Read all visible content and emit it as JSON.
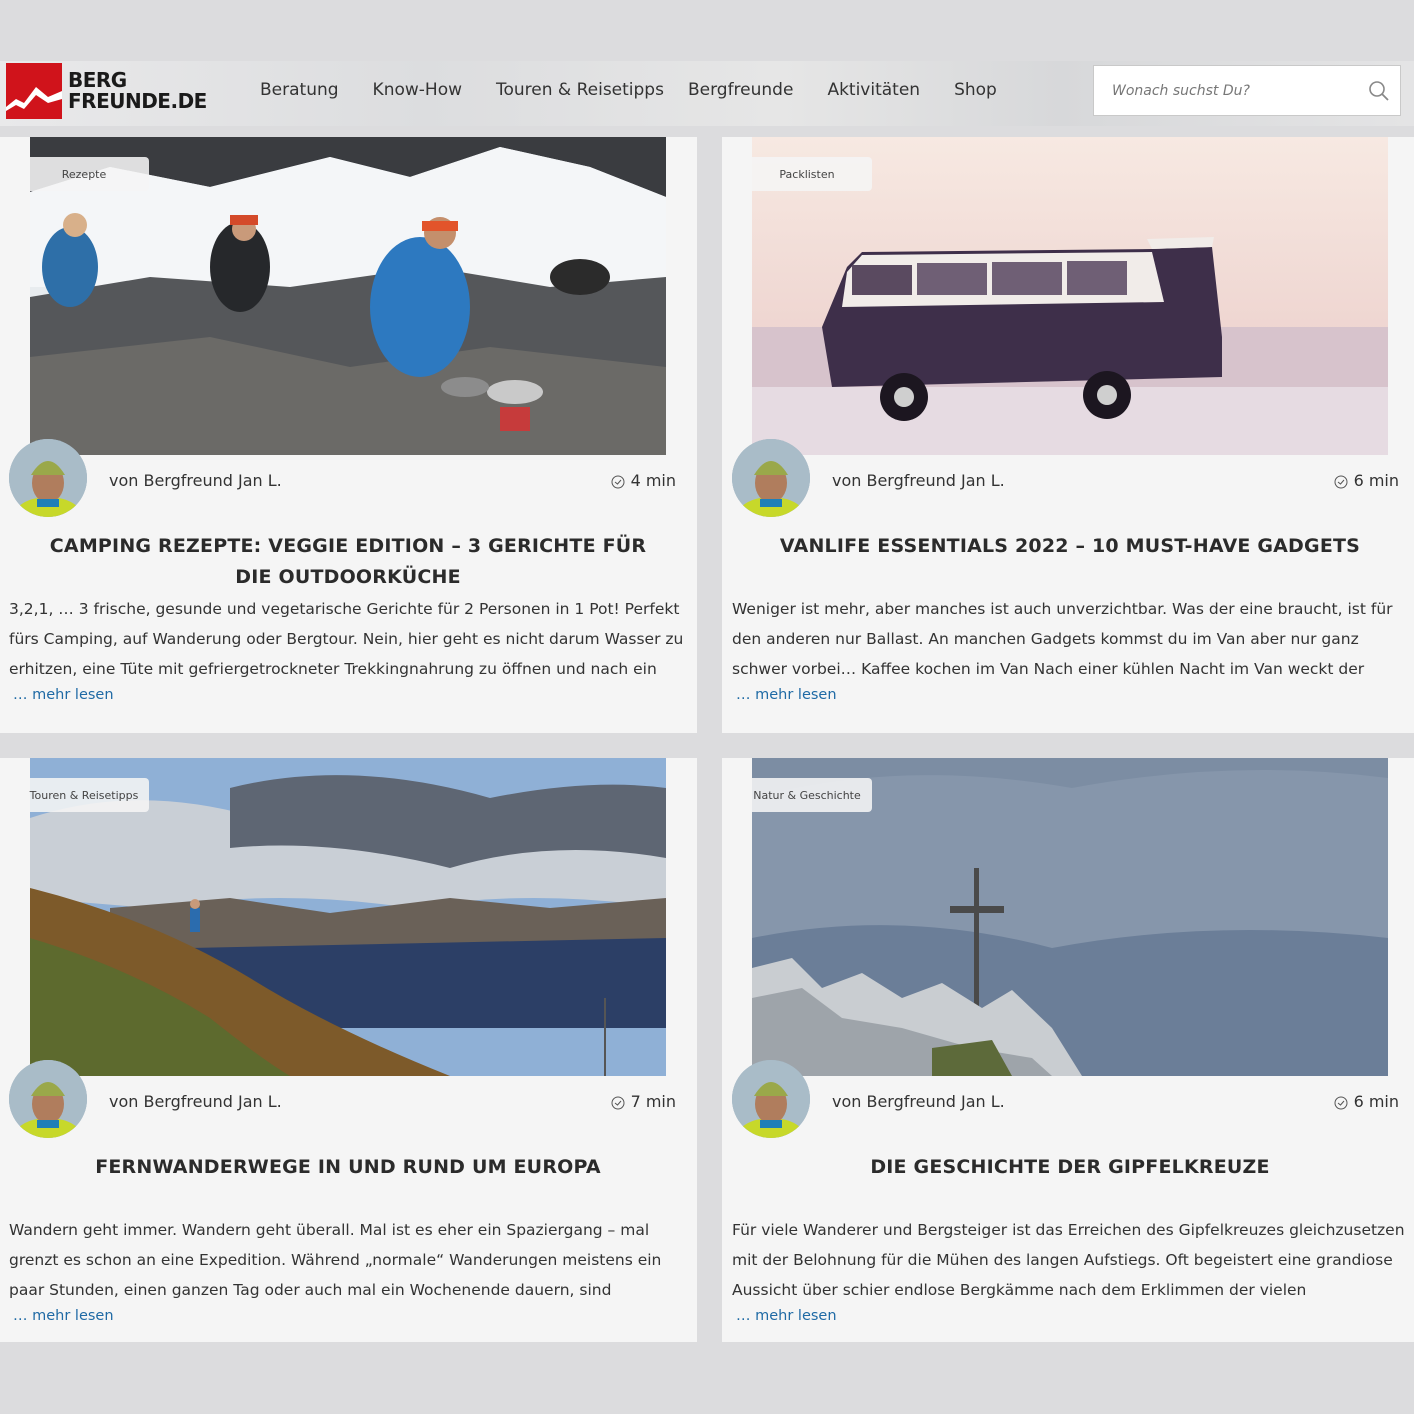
{
  "header": {
    "logo_line1": "BERG",
    "logo_line2": "FREUNDE.DE",
    "nav": [
      "Beratung",
      "Know-How",
      "Touren & Reisetipps",
      "Bergfreunde",
      "Aktivitäten",
      "Shop"
    ],
    "search_placeholder": "Wonach suchst Du?"
  },
  "colors": {
    "brand_red": "#d0131b",
    "link": "#1f6aa5",
    "card_bg": "#f5f5f5"
  },
  "articles": [
    {
      "category": "Rezepte",
      "author": "von Bergfreund Jan L.",
      "read_time": "4 min",
      "title": "Camping Rezepte: Veggie Edition – 3 Gerichte für die Outdoorküche",
      "excerpt": "3,2,1, … 3 frische, gesunde und vegetarische Gerichte für 2 Personen in 1 Pot! Perfekt fürs Camping, auf Wanderung oder Bergtour. Nein, hier geht es nicht darum Wasser zu erhitzen, eine Tüte mit gefriergetrockneter Trekkingnahrung zu öffnen und nach ein paar Minuten, die",
      "more": "… mehr lesen"
    },
    {
      "category": "Packlisten",
      "author": "von Bergfreund Jan L.",
      "read_time": "6 min",
      "title": "Vanlife Essentials 2022 – 10 Must-Have Gadgets",
      "excerpt": "Weniger ist mehr, aber manches ist auch unverzichtbar. Was der eine braucht, ist für den anderen nur Ballast. An manchen Gadgets kommst du im Van aber nur ganz schwer vorbei… Kaffee kochen im Van Nach einer kühlen Nacht im Van weckt der Kaffee am Morgen die",
      "more": "… mehr lesen"
    },
    {
      "category": "Touren & Reisetipps",
      "author": "von Bergfreund Jan L.",
      "read_time": "7 min",
      "title": "Fernwanderwege in und rund um Europa",
      "excerpt": "Wandern geht immer. Wandern geht überall. Mal ist es eher ein Spaziergang – mal grenzt es schon an eine Expedition. Während „normale“ Wanderungen meistens ein paar Stunden, einen ganzen Tag oder auch mal ein Wochenende dauern, sind Fernwanderwege mit",
      "more": "… mehr lesen"
    },
    {
      "category": "Natur & Geschichte",
      "author": "von Bergfreund Jan L.",
      "read_time": "6 min",
      "title": "Die Geschichte der Gipfelkreuze",
      "excerpt": "Für viele Wanderer und Bergsteiger ist das Erreichen des Gipfelkreuzes gleichzusetzen mit der Belohnung für die Mühen des langen Aufstiegs. Oft begeistert eine grandiose Aussicht über schier endlose Bergkämme nach dem Erklimmen der vielen Höhenmeter. Und selbst",
      "more": "… mehr lesen"
    }
  ]
}
